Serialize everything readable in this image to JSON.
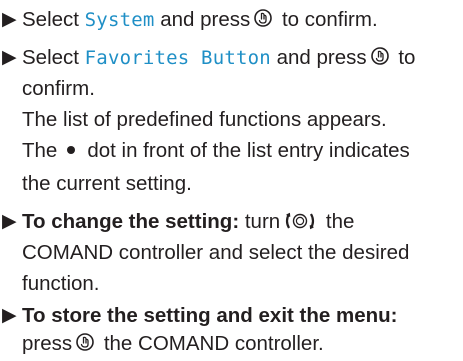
{
  "steps": [
    {
      "lines": [
        {
          "before": "Select ",
          "code": "System",
          "after": " and press",
          "after2": " to confirm."
        }
      ]
    },
    {
      "lines": [
        {
          "before": "Select ",
          "code": "Favorites Button",
          "after": " and press",
          "after2": " to"
        },
        {
          "text": "confirm."
        },
        {
          "text": "The list of predefined functions appears."
        },
        {
          "before": "The",
          "after": "dot in front of the list entry indicates"
        },
        {
          "text": "the current setting."
        }
      ]
    },
    {
      "lines": [
        {
          "bold": "To change the setting:",
          "after": " turn",
          "after2": " the"
        },
        {
          "text": "COMAND controller and select the desired"
        },
        {
          "text": "function."
        }
      ]
    },
    {
      "lines": [
        {
          "bold": "To store the setting and exit the menu:"
        },
        {
          "before": "press",
          "after": " the COMAND controller."
        }
      ]
    }
  ],
  "icons": {
    "arrow": "▶",
    "press": "press-controller-icon",
    "turn": "turn-controller-icon",
    "bullet": "bullet-dot"
  }
}
